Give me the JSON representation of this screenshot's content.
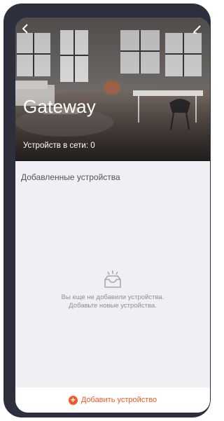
{
  "header": {
    "title": "Gateway",
    "online_devices": "Устройств в сети: 0",
    "back_icon": "chevron-left-icon",
    "edit_icon": "pencil-icon"
  },
  "devices": {
    "section_label": "Добавленные устройства",
    "empty_icon": "empty-tray-icon",
    "empty_line1": "Вы еще не добавили устройства.",
    "empty_line2": "Добавьте новые устройства."
  },
  "footer": {
    "add_icon": "plus-circle-icon",
    "add_label": "Добавить устройство"
  },
  "colors": {
    "accent": "#f05a28",
    "frame": "#2b2f3e",
    "background": "#f0f0f4"
  }
}
